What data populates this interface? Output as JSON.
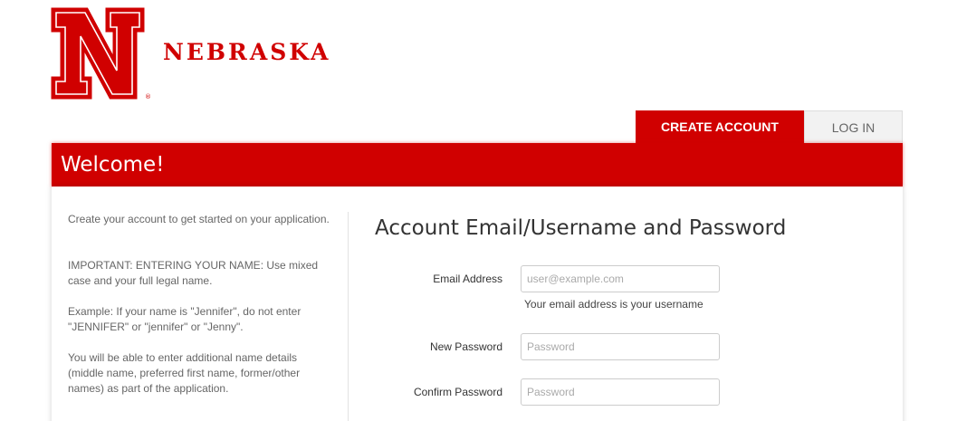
{
  "brand": {
    "name": "NEBRASKA",
    "logo_letter": "N",
    "logo_mark": "®",
    "accent_color": "#d00000"
  },
  "tabs": [
    {
      "label": "CREATE ACCOUNT",
      "active": true
    },
    {
      "label": "LOG IN",
      "active": false
    }
  ],
  "welcome": {
    "title": "Welcome!"
  },
  "sidebar": {
    "paragraphs": [
      "Create your account to get started on your application.",
      "IMPORTANT: ENTERING YOUR NAME: Use mixed case and your full legal name.",
      "Example: If your name is \"Jennifer\", do not enter \"JENNIFER\" or \"jennifer\" or \"Jenny\".",
      "You will be able to enter additional name details (middle name, preferred first name, former/other names) as part of the application."
    ]
  },
  "form": {
    "title": "Account Email/Username and Password",
    "email": {
      "label": "Email Address",
      "placeholder": "user@example.com",
      "value": "",
      "help": "Your email address is your username"
    },
    "new_password": {
      "label": "New Password",
      "placeholder": "Password",
      "value": ""
    },
    "confirm_password": {
      "label": "Confirm Password",
      "placeholder": "Password",
      "value": ""
    }
  }
}
